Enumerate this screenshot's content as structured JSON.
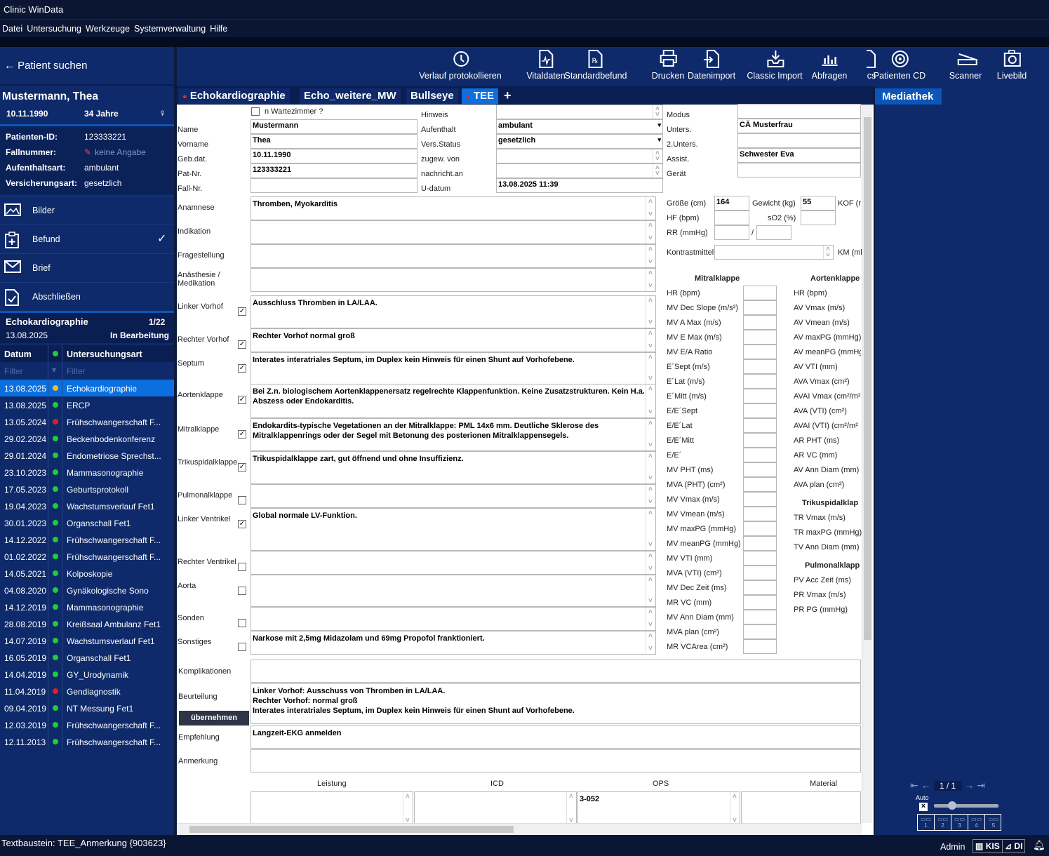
{
  "app": {
    "title": "Clinic WinData"
  },
  "menu": [
    "Datei",
    "Untersuchung",
    "Werkzeuge",
    "Systemverwaltung",
    "Hilfe"
  ],
  "sidebar": {
    "search": "Patient suchen",
    "patient": {
      "name": "Mustermann, Thea",
      "dob": "10.11.1990",
      "age": "34 Jahre"
    },
    "info": [
      {
        "k": "Patienten-ID:",
        "v": "123333221"
      },
      {
        "k": "Fallnummer:",
        "v": "keine Angabe"
      },
      {
        "k": "Aufenthaltsart:",
        "v": "ambulant"
      },
      {
        "k": "Versicherungsart:",
        "v": "gesetzlich"
      }
    ],
    "nav": [
      {
        "label": "Bilder",
        "icon": "image-icon"
      },
      {
        "label": "Befund",
        "icon": "clipboard-plus-icon"
      },
      {
        "label": "Brief",
        "icon": "envelope-icon"
      },
      {
        "label": "Abschließen",
        "icon": "document-check-icon"
      }
    ],
    "exam": {
      "title": "Echokardiographie",
      "count": "1/22",
      "date": "13.08.2025",
      "state": "In Bearbeitung"
    },
    "table": {
      "col_date": "Datum",
      "col_type": "Untersuchungsart",
      "filter": "Filter",
      "rows": [
        {
          "d": "13.08.2025",
          "t": "Echokardiographie",
          "c": "#e8c020"
        },
        {
          "d": "13.08.2025",
          "t": "ERCP",
          "c": "#1fcc3a"
        },
        {
          "d": "13.05.2024",
          "t": "Frühschwangerschaft F...",
          "c": "#e02020"
        },
        {
          "d": "29.02.2024",
          "t": "Beckenbodenkonferenz",
          "c": "#1fcc3a"
        },
        {
          "d": "29.01.2024",
          "t": "Endometriose Sprechst...",
          "c": "#1fcc3a"
        },
        {
          "d": "23.10.2023",
          "t": "Mammasonographie",
          "c": "#1fcc3a"
        },
        {
          "d": "17.05.2023",
          "t": "Geburtsprotokoll",
          "c": "#1fcc3a"
        },
        {
          "d": "19.04.2023",
          "t": "Wachstumsverlauf Fet1",
          "c": "#1fcc3a"
        },
        {
          "d": "30.01.2023",
          "t": "Organschall Fet1",
          "c": "#1fcc3a"
        },
        {
          "d": "14.12.2022",
          "t": "Frühschwangerschaft F...",
          "c": "#1fcc3a"
        },
        {
          "d": "01.02.2022",
          "t": "Frühschwangerschaft F...",
          "c": "#1fcc3a"
        },
        {
          "d": "14.05.2021",
          "t": "Kolposkopie",
          "c": "#1fcc3a"
        },
        {
          "d": "04.08.2020",
          "t": "Gynäkologische Sono",
          "c": "#1fcc3a"
        },
        {
          "d": "14.12.2019",
          "t": "Mammasonographie",
          "c": "#1fcc3a"
        },
        {
          "d": "28.08.2019",
          "t": "Kreißsaal Ambulanz Fet1",
          "c": "#1fcc3a"
        },
        {
          "d": "14.07.2019",
          "t": "Wachstumsverlauf Fet1",
          "c": "#1fcc3a"
        },
        {
          "d": "16.05.2019",
          "t": "Organschall Fet1",
          "c": "#1fcc3a"
        },
        {
          "d": "14.04.2019",
          "t": "GY_Urodynamik",
          "c": "#1fcc3a"
        },
        {
          "d": "11.04.2019",
          "t": "Gendiagnostik",
          "c": "#e02020"
        },
        {
          "d": "09.04.2019",
          "t": "NT Messung Fet1",
          "c": "#1fcc3a"
        },
        {
          "d": "12.03.2019",
          "t": "Frühschwangerschaft F...",
          "c": "#1fcc3a"
        },
        {
          "d": "12.11.2013",
          "t": "Frühschwangerschaft F...",
          "c": "#1fcc3a"
        }
      ]
    }
  },
  "toolbar": [
    {
      "label": "Verlauf protokollieren",
      "icon": "history-icon"
    },
    {
      "label": "Vitaldaten",
      "icon": "vital-file-icon"
    },
    {
      "label": "Standardbefund",
      "icon": "rx-file-icon"
    },
    {
      "label": "Drucken",
      "icon": "printer-icon"
    },
    {
      "label": "Datenimport",
      "icon": "import-icon"
    },
    {
      "label": "Classic Import",
      "icon": "tray-download-icon"
    },
    {
      "label": "Abfragen",
      "icon": "bar-chart-icon"
    },
    {
      "label": "cs",
      "icon": "file-icon"
    },
    {
      "label": "Patienten CD",
      "icon": "disc-icon"
    },
    {
      "label": "Scanner",
      "icon": "scanner-icon"
    },
    {
      "label": "Livebild",
      "icon": "camera-icon"
    }
  ],
  "tabs": [
    "Echokardiographie",
    "Echo_weitere_MW",
    "Bullseye",
    "TEE"
  ],
  "form": {
    "wartezimmer": "n Wartezimmer ?",
    "left": [
      {
        "l": "Name",
        "v": "Mustermann"
      },
      {
        "l": "Vorname",
        "v": "Thea"
      },
      {
        "l": "Geb.dat.",
        "v": "10.11.1990"
      },
      {
        "l": "Pat-Nr.",
        "v": "123333221"
      },
      {
        "l": "Fall-Nr.",
        "v": ""
      }
    ],
    "mid": [
      {
        "l": "Hinweis",
        "v": ""
      },
      {
        "l": "Aufenthalt",
        "v": "ambulant"
      },
      {
        "l": "Vers.Status",
        "v": "gesetzlich"
      },
      {
        "l": "zugew. von",
        "v": ""
      },
      {
        "l": "nachricht.an",
        "v": ""
      },
      {
        "l": "U-datum",
        "v": "13.08.2025 11:39"
      }
    ],
    "right": [
      {
        "l": "Modus",
        "v": ""
      },
      {
        "l": "Unters.",
        "v": "CÄ Musterfrau"
      },
      {
        "l": "2.Unters.",
        "v": ""
      },
      {
        "l": "Assist.",
        "v": "Schwester Eva"
      },
      {
        "l": "Gerät",
        "v": ""
      }
    ],
    "texts": [
      {
        "l": "Anamnese",
        "v": "Thromben, Myokarditis",
        "cb": null
      },
      {
        "l": "Indikation",
        "v": "",
        "cb": null
      },
      {
        "l": "Fragestellung",
        "v": "",
        "cb": null
      },
      {
        "l": "Anästhesie / Medikation",
        "v": "",
        "cb": null
      },
      {
        "l": "Linker Vorhof",
        "v": "Ausschluss Thromben in LA/LAA.",
        "cb": true
      },
      {
        "l": "Rechter Vorhof",
        "v": "Rechter Vorhof normal groß",
        "cb": true
      },
      {
        "l": "Septum",
        "v": "Interates interatriales Septum, im Duplex kein Hinweis für einen Shunt auf Vorhofebene.",
        "cb": true
      },
      {
        "l": "Aortenklappe",
        "v": "Bei Z.n. biologischem Aortenklappenersatz regelrechte Klappenfunktion. Keine Zusatzstrukturen. Kein H.a. Abszess oder Endokarditis.",
        "cb": true
      },
      {
        "l": "Mitralklappe",
        "v": "Endokardits-typische Vegetationen an der Mitralklappe: PML 14x6 mm. Deutliche Sklerose des Mitralklappenrings oder der Segel mit Betonung des posterionen Mitralklappensegels.",
        "cb": true
      },
      {
        "l": "Trikuspidalklappe",
        "v": "Trikuspidalklappe zart, gut öffnend und ohne Insuffizienz.",
        "cb": true
      },
      {
        "l": "Pulmonalklappe",
        "v": "",
        "cb": false
      },
      {
        "l": "Linker  Ventrikel",
        "v": "Global normale LV-Funktion.",
        "cb": true
      },
      {
        "l": "Rechter Ventrikel",
        "v": "",
        "cb": false
      },
      {
        "l": "Aorta",
        "v": "",
        "cb": false
      },
      {
        "l": "Sonden",
        "v": "",
        "cb": false
      },
      {
        "l": "Sonstiges",
        "v": "Narkose mit 2,5mg Midazolam und 69mg Propofol franktioniert.",
        "cb": false
      }
    ],
    "komplikationen": {
      "l": "Komplikationen",
      "v": ""
    },
    "beurteilung": {
      "l": "Beurteilung",
      "v1": "Linker Vorhof: Ausschuss von Thromben in LA/LAA.",
      "v2": "Rechter Vorhof: normal groß",
      "v3": "Interates interatriales Septum, im Duplex kein Hinweis für einen Shunt auf Vorhofebene."
    },
    "uebernehmen": "übernehmen",
    "empfehlung": {
      "l": "Empfehlung",
      "v": "Langzeit-EKG anmelden"
    },
    "anmerkung": {
      "l": "Anmerkung",
      "v": ""
    },
    "bottom_cols": [
      "Leistung",
      "ICD",
      "OPS",
      "Material"
    ],
    "ops_value": "3-052",
    "vitals": {
      "groesse_l": "Größe (cm)",
      "groesse": "164",
      "gewicht_l": "Gewicht (kg)",
      "gewicht": "55",
      "kof_l": "KOF (r",
      "hf_l": "HF (bpm)",
      "so2_l": "sO2 (%)",
      "rr_l": "RR (mmHg)",
      "slash": "/",
      "km_l": "Kontrastmittel",
      "kmml_l": "KM (ml"
    },
    "mitral_title": "Mitralklappe",
    "mitral": [
      "HR (bpm)",
      "MV Dec Slope (m/s²)",
      "MV A Max (m/s)",
      "MV E Max (m/s)",
      "MV E/A Ratio",
      "E´Sept (m/s)",
      "E´Lat (m/s)",
      "E´Mitt (m/s)",
      "E/E´Sept",
      "E/E´Lat",
      "E/E´Mitt",
      "E/E´",
      "MV PHT (ms)",
      "MVA (PHT) (cm²)",
      "MV Vmax (m/s)",
      "MV Vmean (m/s)",
      "MV maxPG (mmHg)",
      "MV meanPG (mmHg)",
      "MV VTI (mm)",
      "MVA (VTI) (cm²)",
      "MV Dec Zeit (ms)",
      "MR VC (mm)",
      "MV Ann Diam (mm)",
      "MVA plan (cm²)",
      "MR VCArea (cm²)"
    ],
    "aortic_title": "Aortenklappe",
    "aortic": [
      "HR (bpm)",
      "AV Vmax (m/s)",
      "AV Vmean (m/s)",
      "AV maxPG (mmHg)",
      "AV meanPG (mmHg",
      "AV VTI (mm)",
      "AVA Vmax (cm²)",
      "AVAI Vmax (cm²/m²",
      "AVA (VTI) (cm²)",
      "AVAI (VTI) (cm²/m²",
      "AR PHT (ms)",
      "AR VC (mm)",
      "AV Ann Diam (mm)",
      "AVA plan (cm²)"
    ],
    "tricus_title": "Trikuspidalklap",
    "tricus": [
      "TR Vmax (m/s)",
      "TR maxPG (mmHg)",
      "TV Ann Diam (mm)"
    ],
    "pulm_title": "Pulmonalklapp",
    "pulm": [
      "PV Acc Zeit (ms)",
      "PR Vmax (m/s)",
      "PR PG (mmHg)"
    ]
  },
  "media": {
    "tab": "Mediathek",
    "page": "1 / 1",
    "auto": "Auto",
    "slots": [
      "1",
      "2",
      "3",
      "4",
      "5"
    ]
  },
  "status": {
    "text": "Textbaustein: TEE_Anmerkung {903623}",
    "user": "Admin",
    "kis": "KIS",
    "di": "DI"
  }
}
